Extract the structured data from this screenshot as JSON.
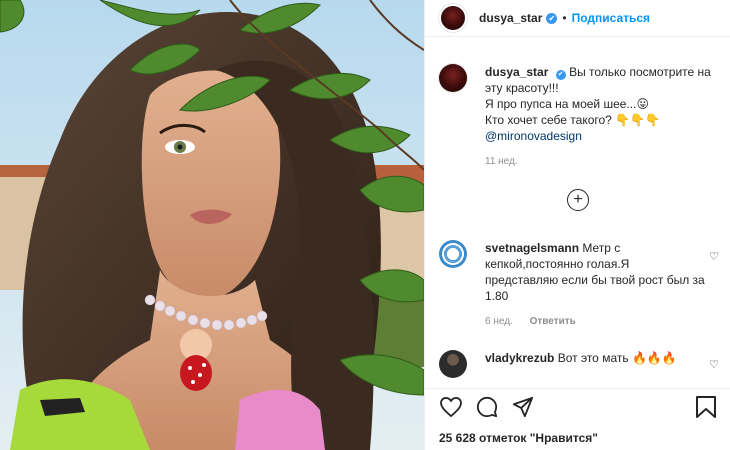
{
  "post": {
    "username": "dusya_star",
    "verified_mark": "✔",
    "follow_label": "Подписаться",
    "dot": "•",
    "more_label": "•••"
  },
  "caption": {
    "username": "dusya_star",
    "line1": "Вы только посмотрите на эту красоту!!!",
    "line2": "Я про пупса на моей шее...",
    "emoji1": "😛",
    "line3": "Кто хочет себе такого?",
    "emoji2": "👇👇👇",
    "mention": "@mironovadesign",
    "time": "11 нед."
  },
  "load_more_icon": "plus-circle-icon",
  "comments": [
    {
      "username": "svetnagelsmann",
      "text": "Метр с кепкой,постоянно голая.Я представляю если бы твой рост был за 1.80",
      "time": "6 нед.",
      "reply_label": "Ответить"
    },
    {
      "username": "vladykrezub",
      "text": "Вот это мать",
      "emoji": "🔥🔥🔥"
    }
  ],
  "actions": {
    "icons": [
      "heart-icon",
      "comment-icon",
      "share-icon",
      "bookmark-icon"
    ]
  },
  "likes": {
    "count": "25 628",
    "label": "отметок \"Нравится\""
  },
  "colors": {
    "accent": "#0095f6",
    "verified": "#3897f0",
    "text": "#262626",
    "muted": "#8e8e8e",
    "mention": "#00376b"
  }
}
